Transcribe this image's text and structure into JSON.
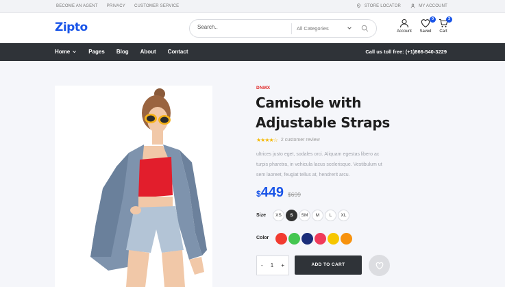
{
  "topbar": {
    "links": [
      "BECOME AN AGENT",
      "PRIVACY",
      "CUSTOMER SERVICE"
    ],
    "store_locator": "STORE LOCATOR",
    "my_account": "MY ACCOUNT"
  },
  "header": {
    "logo": "Zipto",
    "search_placeholder": "Search..",
    "category_select": "All Categories",
    "account_label": "Account",
    "saved_label": "Saved",
    "saved_count": "0",
    "cart_label": "Cart",
    "cart_count": "3"
  },
  "nav": {
    "items": [
      "Home",
      "Pages",
      "Blog",
      "About",
      "Contact"
    ],
    "phone": "Call us toll free: (+1)866-540-3229"
  },
  "product": {
    "brand": "DNMX",
    "title": "Camisole with Adjustable Straps",
    "rating": 4,
    "review_text": "2 customer review",
    "description": "ultrices justo eget, sodales orci. Aliquam egestas libero ac turpis pharetra, in vehicula lacus scelerisque. Vestibulum ut sem laoreet, feugiat tellus at, hendrerit arcu.",
    "currency": "$",
    "price": "449",
    "old_price": "$699",
    "size_label": "Size",
    "sizes": [
      "XS",
      "S",
      "SM",
      "M",
      "L",
      "XL"
    ],
    "selected_size": "S",
    "color_label": "Color",
    "colors": [
      "#f23b30",
      "#44c650",
      "#1a2d7a",
      "#f03a5a",
      "#f6c600",
      "#f7920e"
    ],
    "quantity": "1",
    "qty_minus": "-",
    "qty_plus": "+",
    "add_to_cart": "ADD TO CART"
  },
  "colors": {
    "accent": "#1a55e8",
    "nav_bg": "#2f3338",
    "brand_red": "#e02020"
  }
}
